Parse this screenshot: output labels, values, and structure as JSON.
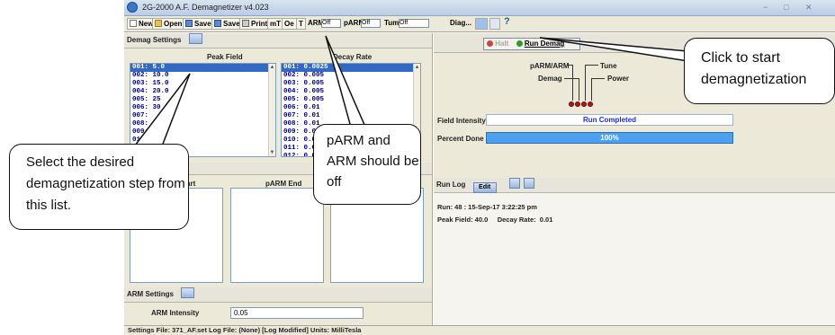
{
  "window": {
    "title": "2G-2000 A.F. Demagnetizer v4.023",
    "controls": [
      "−",
      "□",
      "✕"
    ]
  },
  "toolbar": {
    "new": "New",
    "open": "Open",
    "save_as": "Save",
    "save": "Save",
    "print": "Print",
    "mt": "mT",
    "oe": "Oe",
    "t": "T",
    "arm_label": "ARM",
    "arm_value": "Off",
    "parm_label": "pARM",
    "parm_value": "Off",
    "tumbler_label": "Tumbl",
    "tumbler_value": "Off",
    "diag": "Diag..."
  },
  "demag_settings": {
    "header": "Demag Settings",
    "peak_field_header": "Peak Field",
    "decay_rate_header": "Decay Rate",
    "peak_field_items": [
      "001: 5.0",
      "002: 10.0",
      "003: 15.0",
      "004: 20.0",
      "005: 25",
      "006: 30",
      "007:",
      "008:",
      "009:",
      "010: 5",
      "011:",
      "012: 8"
    ],
    "decay_rate_items": [
      "001: 0.0025",
      "002: 0.005",
      "003: 0.005",
      "004: 0.005",
      "005: 0.005",
      "006: 0.01",
      "007: 0.01",
      "008: 0.01",
      "009: 0.01",
      "010: 0.01",
      "011: 0.01",
      "012: 0.01"
    ]
  },
  "parm": {
    "start_header": "Start",
    "end_header": "pARM End"
  },
  "arm_settings": {
    "header": "ARM Settings",
    "intensity_label": "ARM Intensity",
    "intensity_value": "0.05"
  },
  "status_bar": "Settings File:  371_AF.set Log File: (None)   [Log Modified] Units: MilliTesla",
  "right": {
    "halt_label": "Halt",
    "run_label": "Run Demag",
    "led_labels": {
      "parm_arm": "pARM/ARM",
      "tune": "Tune",
      "demag": "Demag",
      "power": "Power"
    },
    "field_intensity_label": "Field Intensity",
    "field_intensity_value": "Run Completed",
    "percent_done_label": "Percent Done",
    "percent_done_value": "100%",
    "percent_done_fraction": 1.0,
    "run_log_header": "Run Log",
    "run_log_edit": "Edit",
    "log_line1": "Run: 48 : 15-Sep-17 3:22:25 pm",
    "log_line2": "Peak Field: 40.0     Decay Rate:  0.01"
  },
  "callouts": {
    "start": "Click to start demagnetization",
    "parm": "pARM and ARM should be off",
    "select": "Select the desired demagnetization step from this list."
  }
}
